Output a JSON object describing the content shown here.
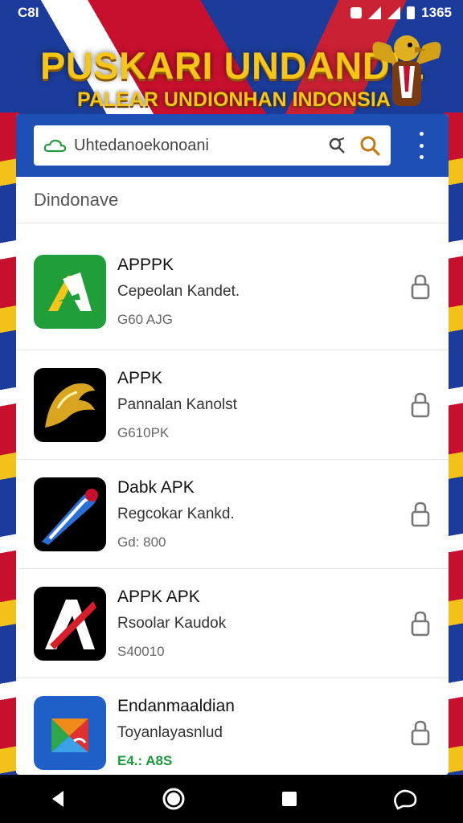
{
  "status_bar": {
    "left_text": "C8I",
    "time": "1365"
  },
  "banner": {
    "title": "PUSKARI UNDANDIL",
    "subtitle": "PALEAR UNDIONHAN INDONSIA"
  },
  "search": {
    "placeholder": "Uhtedanoekonoani"
  },
  "section": {
    "label": "Dindonave"
  },
  "apps": [
    {
      "name": "APPPK",
      "desc": "Cepeolan Kandet.",
      "meta": "G60 AJG",
      "icon": "green-apk-icon",
      "meta_color": "#666666"
    },
    {
      "name": "APPK",
      "desc": "Pannalan Kanolst",
      "meta": "G610PK",
      "icon": "gold-bird-icon",
      "meta_color": "#666666"
    },
    {
      "name": "Dabk APK",
      "desc": "Regcokar Kankd.",
      "meta": "Gd: 800",
      "icon": "rocket-icon",
      "meta_color": "#666666"
    },
    {
      "name": "APPK APK",
      "desc": "Rsoolar Kaudok",
      "meta": "S40010",
      "icon": "red-arrow-icon",
      "meta_color": "#666666"
    },
    {
      "name": "Endanmaaldian",
      "desc": "Toyanlayasnlud",
      "meta": "E4.: A8S",
      "icon": "colorful-cube-icon",
      "meta_color": "#1a9a3a"
    }
  ],
  "colors": {
    "accent_blue": "#1e4fb4",
    "banner_gold": "#f5c518"
  }
}
